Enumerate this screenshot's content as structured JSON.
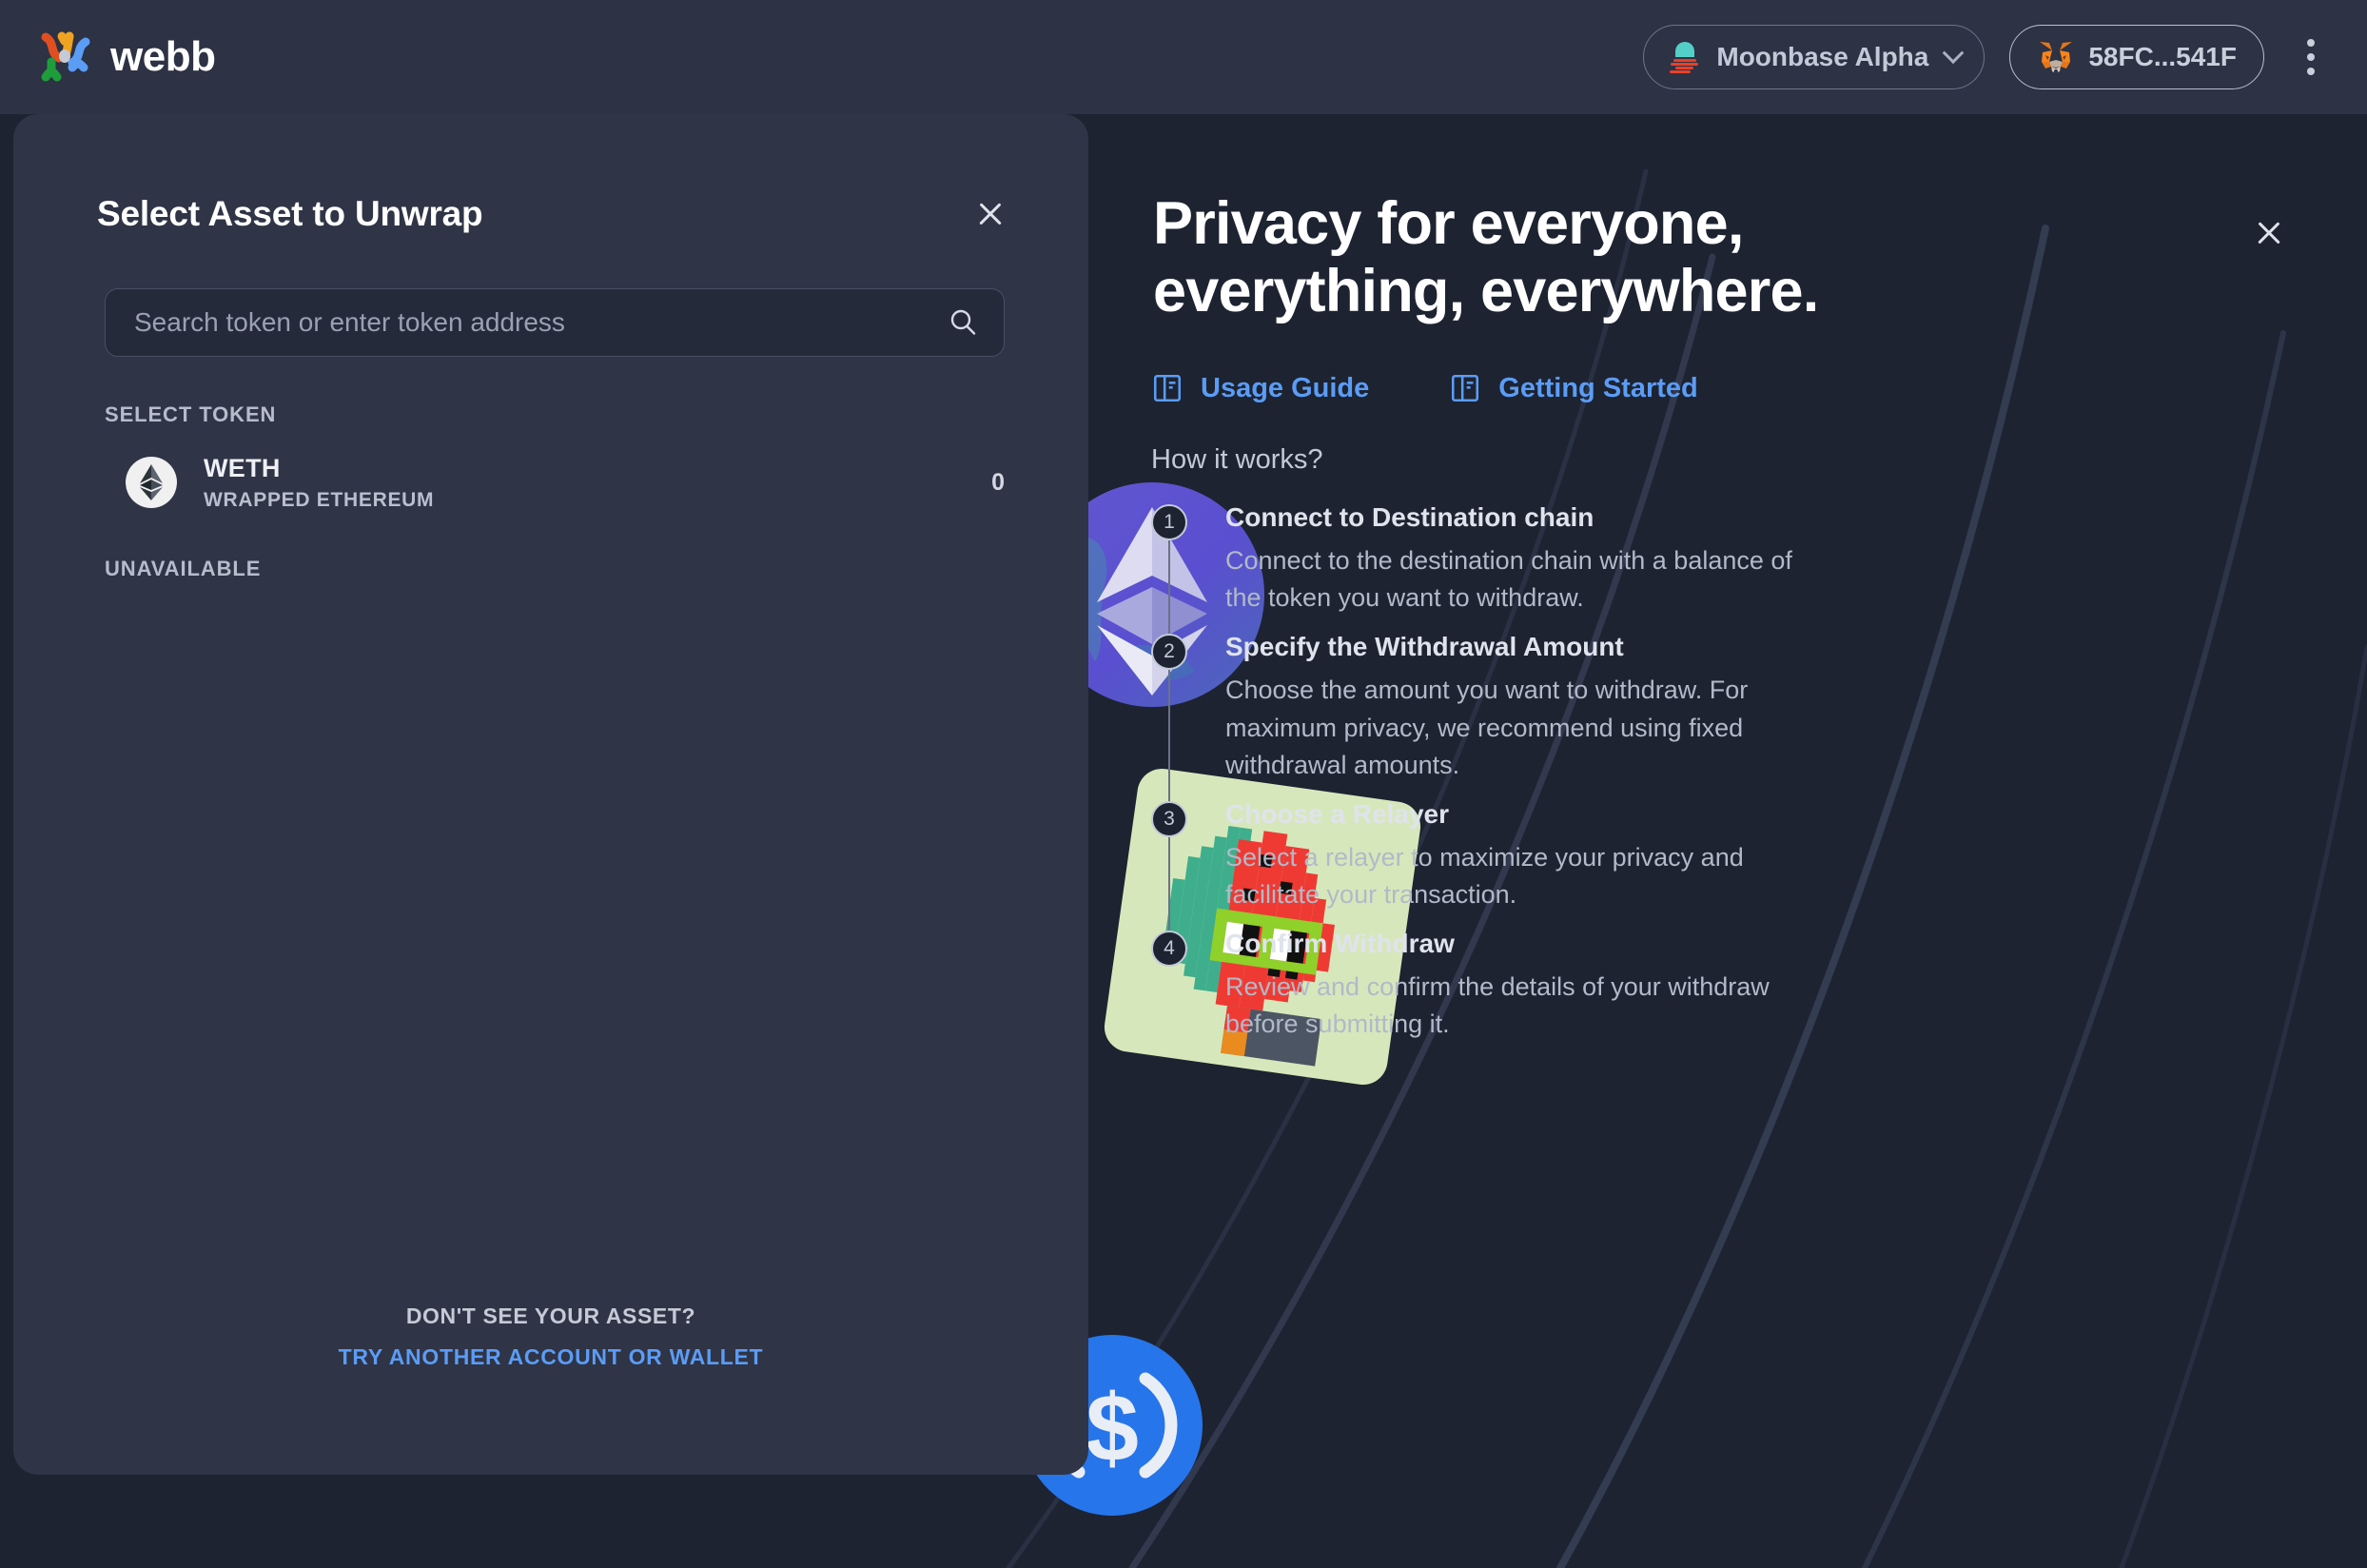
{
  "brand": {
    "name": "webb",
    "logo_icon": "webb-logo-icon"
  },
  "topbar": {
    "network": {
      "label": "Moonbase Alpha",
      "icon": "moonbeam-icon",
      "chevron_icon": "chevron-down-icon"
    },
    "wallet": {
      "address": "58FC...541F",
      "icon": "metamask-fox-icon"
    },
    "menu": {
      "icon": "kebab-menu-icon"
    }
  },
  "modal": {
    "title": "Select Asset to Unwrap",
    "close_icon": "close-icon",
    "search": {
      "placeholder": "Search token or enter token address",
      "value": "",
      "icon": "search-icon"
    },
    "section_label": "SELECT TOKEN",
    "tokens": [
      {
        "symbol": "WETH",
        "name": "WRAPPED ETHEREUM",
        "balance": "0",
        "icon": "ethereum-token-icon"
      }
    ],
    "unavailable_label": "UNAVAILABLE",
    "footer": {
      "question": "DON'T SEE YOUR ASSET?",
      "link": "TRY ANOTHER ACCOUNT OR WALLET"
    }
  },
  "hero": {
    "close_icon": "close-icon",
    "title_line1": "Privacy for everyone,",
    "title_line2": "everything, everywhere.",
    "links": [
      {
        "label": "Usage Guide",
        "icon": "book-icon"
      },
      {
        "label": "Getting Started",
        "icon": "book-icon"
      }
    ],
    "how_title": "How it works?",
    "steps": [
      {
        "num": "1",
        "title": "Connect to Destination chain",
        "desc": "Connect to the destination chain with a balance of the token you want to withdraw."
      },
      {
        "num": "2",
        "title": "Specify the Withdrawal Amount",
        "desc": "Choose the amount you want to withdraw. For maximum privacy, we recommend using fixed withdrawal amounts."
      },
      {
        "num": "3",
        "title": "Choose a Relayer",
        "desc": "Select a relayer to maximize your privacy and facilitate your transaction."
      },
      {
        "num": "4",
        "title": "Confirm Withdraw",
        "desc": "Review and confirm the details of your withdraw before submitting it."
      }
    ]
  },
  "decorations": [
    {
      "icon": "ethereum-coin-icon"
    },
    {
      "icon": "usdc-coin-icon"
    },
    {
      "icon": "pixel-watermelon-nft-icon"
    }
  ],
  "colors": {
    "background": "#1d2331",
    "topbar": "#2d3244",
    "panel": "#2f3446",
    "accent_blue": "#5b9cf5",
    "text_primary": "#ffffff",
    "text_secondary": "#b2b9c8"
  }
}
